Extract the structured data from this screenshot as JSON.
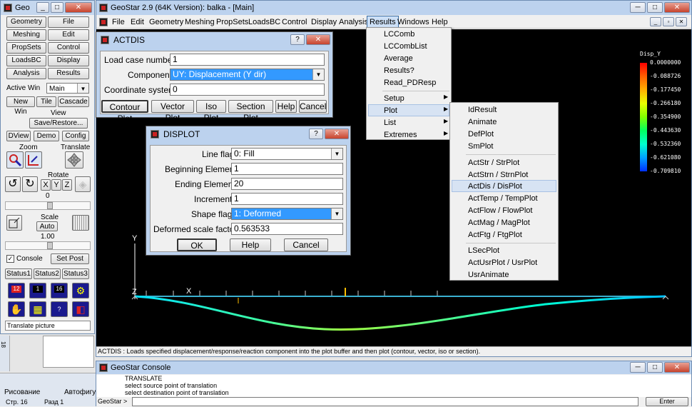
{
  "tool_window": {
    "title": "Geo",
    "buttons": [
      "Geometry",
      "File",
      "Meshing",
      "Edit",
      "PropSets",
      "Control",
      "LoadsBC",
      "Display",
      "Analysis",
      "Results"
    ],
    "active_win_label": "Active Win",
    "active_win_value": "Main",
    "row_btns": [
      "New Win",
      "Tile",
      "Cascade"
    ],
    "view_label": "View",
    "save_restore": "Save/Restore...",
    "row2": [
      "DView",
      "Demo",
      "Config"
    ],
    "zoom_label": "Zoom",
    "translate_label": "Translate",
    "rotate_label": "Rotate",
    "xyz": [
      "X",
      "Y",
      "Z"
    ],
    "rotate_value": "0",
    "scale_label": "Scale",
    "scale_auto": "Auto",
    "scale_value": "1.00",
    "console_label": "Console",
    "set_post": "Set Post",
    "status": [
      "Status1",
      "Status2",
      "Status3"
    ],
    "icon_labels": [
      "12",
      "1",
      "16"
    ],
    "status_text": "Translate picture"
  },
  "main_window": {
    "title": "GeoStar 2.9 (64K Version): balka - [Main]",
    "menu": [
      "File",
      "Edit",
      "Geometry",
      "Meshing",
      "PropSets",
      "LoadsBC",
      "Control",
      "Display",
      "Analysis",
      "Results",
      "Windows",
      "Help"
    ],
    "status_bar": "ACTDIS : Loads specified displacement/response/reaction component into the plot buffer and then plot (contour, vector, iso or section)."
  },
  "legend": {
    "title": "Disp_Y",
    "values": [
      "0.0000000",
      "-0.088726",
      "-0.177450",
      "-0.266180",
      "-0.354900",
      "-0.443630",
      "-0.532360",
      "-0.621080",
      "-0.709810"
    ],
    "colors": [
      "#ff0000",
      "#ff6000",
      "#ffb000",
      "#e8ff00",
      "#80ff00",
      "#00ff60",
      "#00ffd0",
      "#00a0ff",
      "#0030ff"
    ]
  },
  "axes": {
    "y": "Y",
    "x": "X",
    "z": "Z"
  },
  "results_menu": {
    "items": [
      "LCComb",
      "LCCombList",
      "Average",
      "Results?",
      "Read_PDResp",
      "Setup",
      "Plot",
      "List",
      "Extremes"
    ]
  },
  "plot_menu": {
    "items": [
      "IdResult",
      "Animate",
      "DefPlot",
      "SmPlot",
      "ActStr / StrPlot",
      "ActStrn / StrnPlot",
      "ActDis / DisPlot",
      "ActTemp / TempPlot",
      "ActFlow / FlowPlot",
      "ActMag / MagPlot",
      "ActFtg / FtgPlot",
      "LSecPlot",
      "ActUsrPlot / UsrPlot",
      "UsrAnimate"
    ]
  },
  "actdis": {
    "title": "ACTDIS",
    "load_case_label": "Load case number",
    "load_case_value": "1",
    "component_label": "Component",
    "component_value": "UY: Displacement (Y dir)",
    "coord_label": "Coordinate system",
    "coord_value": "0",
    "buttons": [
      "Contour Plot",
      "Vector Plot",
      "Iso Plot",
      "Section Plot",
      "Help",
      "Cancel"
    ]
  },
  "displot": {
    "title": "DISPLOT",
    "line_flag_label": "Line flag",
    "line_flag_value": "0: Fill",
    "beg_label": "Beginning Element",
    "beg_value": "1",
    "end_label": "Ending Element",
    "end_value": "20",
    "inc_label": "Increment",
    "inc_value": "1",
    "shape_label": "Shape flag",
    "shape_value": "1: Deformed",
    "scale_label": "Deformed scale factor",
    "scale_value": "0.563533",
    "buttons": [
      "OK",
      "Help",
      "Cancel"
    ]
  },
  "console": {
    "title": "GeoStar Console",
    "lines": [
      "TRANSLATE",
      "select source point of translation",
      "select destination point of translation"
    ],
    "prompt": "GeoStar >",
    "enter": "Enter"
  },
  "word": {
    "draw_label": "Рисование",
    "autoshape": "Автофигу",
    "page": "Стр. 16",
    "section": "Разд 1",
    "ruler": "18"
  }
}
